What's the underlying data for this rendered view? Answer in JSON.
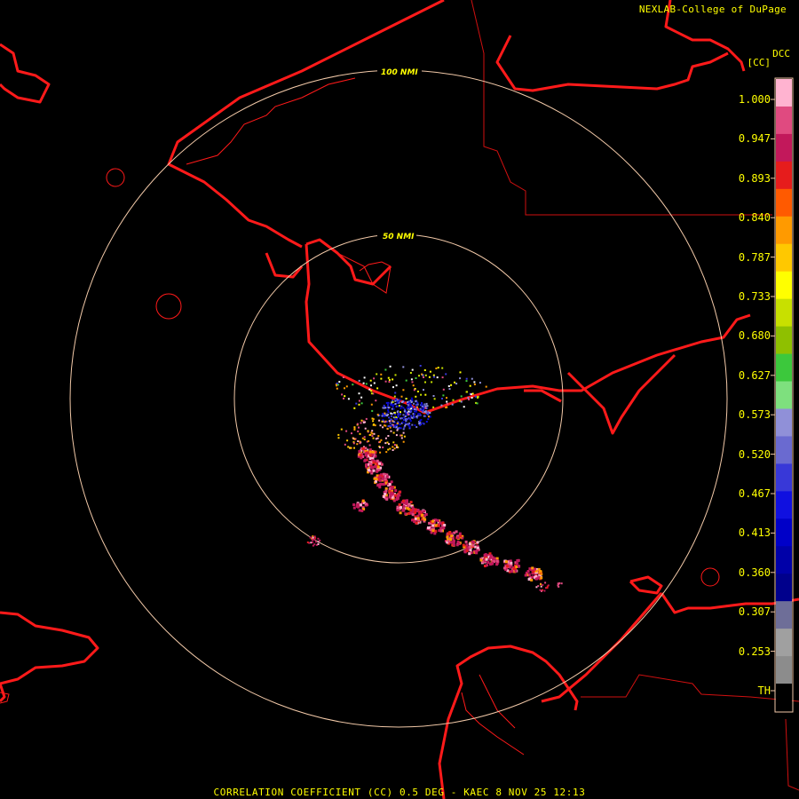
{
  "credit": "NEXLAB-College of DuPage",
  "product_code": "DCC",
  "product_unit": "[CC]",
  "range_rings": [
    {
      "label": "50 NMI"
    },
    {
      "label": "100 NMI"
    }
  ],
  "colorbar": {
    "ticks": [
      "1.000",
      "0.947",
      "0.893",
      "0.840",
      "0.787",
      "0.733",
      "0.680",
      "0.627",
      "0.573",
      "0.520",
      "0.467",
      "0.413",
      "0.360",
      "0.307",
      "0.253",
      "TH"
    ],
    "colors": [
      "#ffb3d0",
      "#e04a80",
      "#c2185b",
      "#e61c1c",
      "#ff5a00",
      "#ff9a00",
      "#ffc800",
      "#ffff00",
      "#c8e000",
      "#8fc000",
      "#3cc83c",
      "#7ee07e",
      "#9090d8",
      "#6a6ad0",
      "#3838d8",
      "#1010e0",
      "#0000c8",
      "#0000a8",
      "#00008c",
      "#6e6e98",
      "#a0a0a0",
      "#8c8c8c",
      "#000000"
    ]
  },
  "status_text": "CORRELATION COEFFICIENT (CC) 0.5 DEG - KAEC 8 NOV 25 12:13",
  "colors": {
    "background": "#000000",
    "coastline": "#ff1a1a",
    "range_ring": "#f2c9a8",
    "text": "#ffff00"
  }
}
